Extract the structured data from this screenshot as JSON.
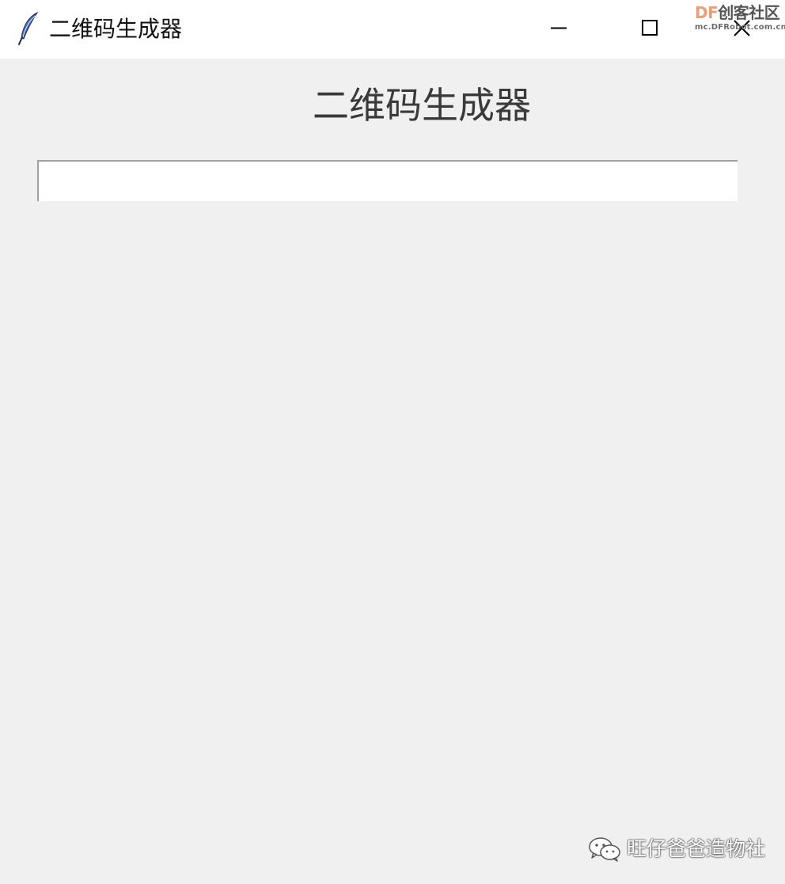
{
  "window": {
    "title": "二维码生成器",
    "controls": {
      "minimize_icon": "minimize-icon",
      "maximize_icon": "maximize-icon",
      "close_icon": "close-icon"
    },
    "app_icon": "feather-icon"
  },
  "main": {
    "heading": "二维码生成器",
    "entry": {
      "value": "",
      "placeholder": ""
    }
  },
  "watermarks": {
    "top_brand_accent": "DF",
    "top_brand_rest": "创客社区",
    "top_url": "mc.DFRobot.com.cn",
    "bottom_account": "旺仔爸爸造物社",
    "bottom_icon": "wechat-icon"
  },
  "colors": {
    "background": "#f0f0f0",
    "titlebar": "#ffffff",
    "brand_accent": "#e9a07a"
  }
}
